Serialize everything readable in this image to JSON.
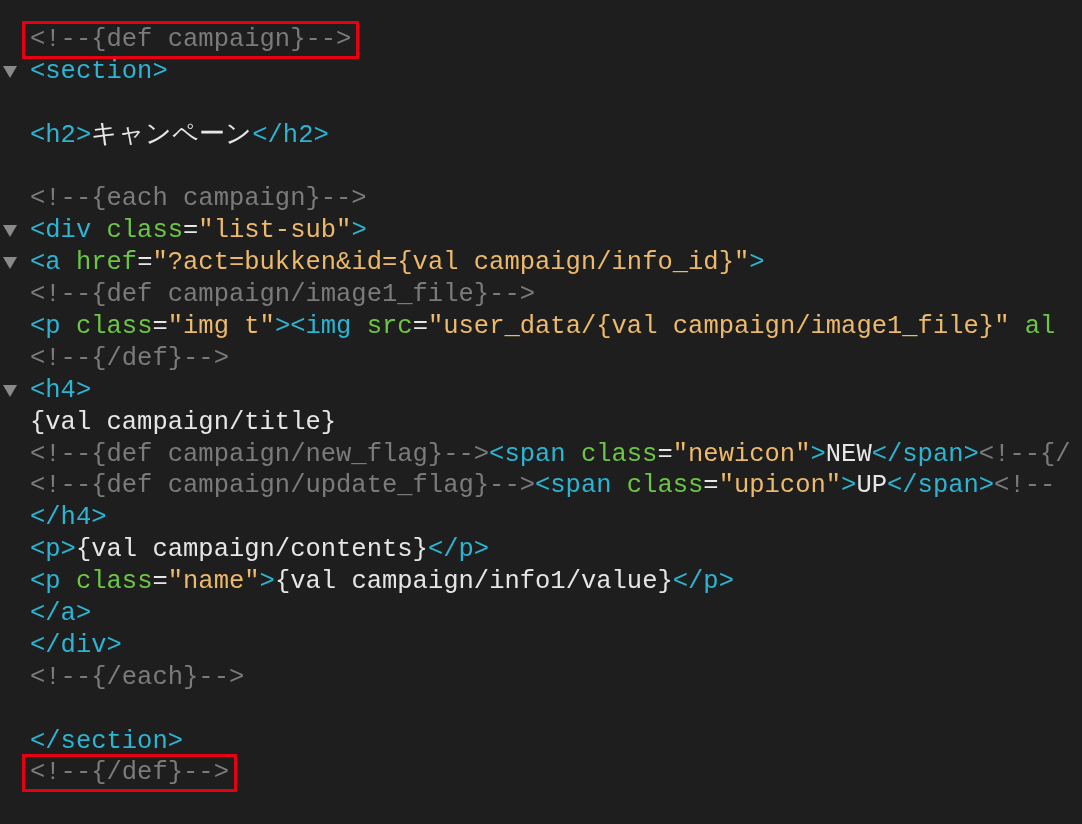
{
  "lines": [
    {
      "fold_marker": false,
      "highlighted": true,
      "tokens": [
        {
          "kind": "comment",
          "text": "<!--{def campaign}-->"
        }
      ]
    },
    {
      "fold_marker": true,
      "highlighted": false,
      "tokens": [
        {
          "kind": "tag",
          "text": "<section>"
        }
      ]
    },
    {
      "fold_marker": false,
      "highlighted": false
    },
    {
      "fold_marker": false,
      "highlighted": false,
      "tokens": [
        {
          "kind": "tag",
          "text": "<h2>"
        },
        {
          "kind": "text",
          "text": "キャンペーン"
        },
        {
          "kind": "tag",
          "text": "</h2>"
        }
      ]
    },
    {
      "fold_marker": false,
      "highlighted": false
    },
    {
      "fold_marker": false,
      "highlighted": false,
      "tokens": [
        {
          "kind": "comment",
          "text": "<!--{each campaign}-->"
        }
      ]
    },
    {
      "fold_marker": true,
      "highlighted": false,
      "tokens": [
        {
          "kind": "tag",
          "text": "<div "
        },
        {
          "kind": "attr",
          "text": "class"
        },
        {
          "kind": "text",
          "text": "="
        },
        {
          "kind": "string",
          "text": "\"list-sub\""
        },
        {
          "kind": "tag",
          "text": ">"
        }
      ]
    },
    {
      "fold_marker": true,
      "highlighted": false,
      "tokens": [
        {
          "kind": "tag",
          "text": "<a "
        },
        {
          "kind": "attr",
          "text": "href"
        },
        {
          "kind": "text",
          "text": "="
        },
        {
          "kind": "string",
          "text": "\"?act=bukken&id={val campaign/info_id}\""
        },
        {
          "kind": "tag",
          "text": ">"
        }
      ]
    },
    {
      "fold_marker": false,
      "highlighted": false,
      "tokens": [
        {
          "kind": "comment",
          "text": "<!--{def campaign/image1_file}-->"
        }
      ]
    },
    {
      "fold_marker": false,
      "highlighted": false,
      "tokens": [
        {
          "kind": "tag",
          "text": "<p "
        },
        {
          "kind": "attr",
          "text": "class"
        },
        {
          "kind": "text",
          "text": "="
        },
        {
          "kind": "string",
          "text": "\"img t\""
        },
        {
          "kind": "tag",
          "text": "><img "
        },
        {
          "kind": "attr",
          "text": "src"
        },
        {
          "kind": "text",
          "text": "="
        },
        {
          "kind": "string",
          "text": "\"user_data/{val campaign/image1_file}\""
        },
        {
          "kind": "attr",
          "text": " al"
        }
      ]
    },
    {
      "fold_marker": false,
      "highlighted": false,
      "tokens": [
        {
          "kind": "comment",
          "text": "<!--{/def}-->"
        }
      ]
    },
    {
      "fold_marker": true,
      "highlighted": false,
      "tokens": [
        {
          "kind": "tag",
          "text": "<h4>"
        }
      ]
    },
    {
      "fold_marker": false,
      "highlighted": false,
      "tokens": [
        {
          "kind": "text",
          "text": "{val campaign/title}"
        }
      ]
    },
    {
      "fold_marker": false,
      "highlighted": false,
      "tokens": [
        {
          "kind": "comment",
          "text": "<!--{def campaign/new_flag}-->"
        },
        {
          "kind": "tag",
          "text": "<span "
        },
        {
          "kind": "attr",
          "text": "class"
        },
        {
          "kind": "text",
          "text": "="
        },
        {
          "kind": "string",
          "text": "\"newicon\""
        },
        {
          "kind": "tag",
          "text": ">"
        },
        {
          "kind": "text",
          "text": "NEW"
        },
        {
          "kind": "tag",
          "text": "</span>"
        },
        {
          "kind": "comment",
          "text": "<!--{/"
        }
      ]
    },
    {
      "fold_marker": false,
      "highlighted": false,
      "tokens": [
        {
          "kind": "comment",
          "text": "<!--{def campaign/update_flag}-->"
        },
        {
          "kind": "tag",
          "text": "<span "
        },
        {
          "kind": "attr",
          "text": "class"
        },
        {
          "kind": "text",
          "text": "="
        },
        {
          "kind": "string",
          "text": "\"upicon\""
        },
        {
          "kind": "tag",
          "text": ">"
        },
        {
          "kind": "text",
          "text": "UP"
        },
        {
          "kind": "tag",
          "text": "</span>"
        },
        {
          "kind": "comment",
          "text": "<!--"
        }
      ]
    },
    {
      "fold_marker": false,
      "highlighted": false,
      "tokens": [
        {
          "kind": "tag",
          "text": "</h4>"
        }
      ]
    },
    {
      "fold_marker": false,
      "highlighted": false,
      "tokens": [
        {
          "kind": "tag",
          "text": "<p>"
        },
        {
          "kind": "text",
          "text": "{val campaign/contents}"
        },
        {
          "kind": "tag",
          "text": "</p>"
        }
      ]
    },
    {
      "fold_marker": false,
      "highlighted": false,
      "tokens": [
        {
          "kind": "tag",
          "text": "<p "
        },
        {
          "kind": "attr",
          "text": "class"
        },
        {
          "kind": "text",
          "text": "="
        },
        {
          "kind": "string",
          "text": "\"name\""
        },
        {
          "kind": "tag",
          "text": ">"
        },
        {
          "kind": "text",
          "text": "{val campaign/info1/value}"
        },
        {
          "kind": "tag",
          "text": "</p>"
        }
      ]
    },
    {
      "fold_marker": false,
      "highlighted": false,
      "tokens": [
        {
          "kind": "tag",
          "text": "</a>"
        }
      ]
    },
    {
      "fold_marker": false,
      "highlighted": false,
      "tokens": [
        {
          "kind": "tag",
          "text": "</div>"
        }
      ]
    },
    {
      "fold_marker": false,
      "highlighted": false,
      "tokens": [
        {
          "kind": "comment",
          "text": "<!--{/each}-->"
        }
      ]
    },
    {
      "fold_marker": false,
      "highlighted": false
    },
    {
      "fold_marker": false,
      "highlighted": false,
      "tokens": [
        {
          "kind": "tag",
          "text": "</section>"
        }
      ]
    },
    {
      "fold_marker": false,
      "highlighted": true,
      "tokens": [
        {
          "kind": "comment",
          "text": "<!--{/def}-->"
        }
      ]
    }
  ]
}
